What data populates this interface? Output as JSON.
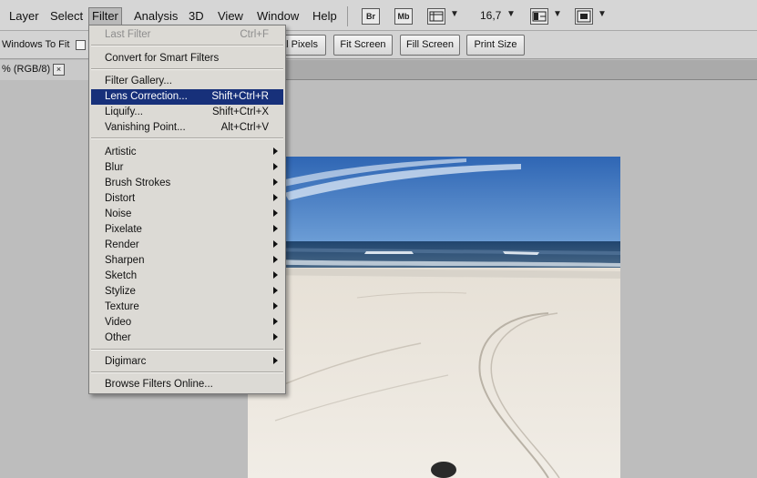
{
  "menubar": {
    "items": [
      "Layer",
      "Select",
      "Filter",
      "Analysis",
      "3D",
      "View",
      "Window",
      "Help"
    ],
    "bridge_icon": "Br",
    "minibridge_icon": "Mb",
    "zoom": "16,7"
  },
  "options": {
    "resize_label": "Windows To Fit",
    "buttons": [
      "al Pixels",
      "Fit Screen",
      "Fill Screen",
      "Print Size"
    ]
  },
  "document": {
    "tab_label": "% (RGB/8)",
    "close_glyph": "×"
  },
  "filter_menu": {
    "last_filter": {
      "label": "Last Filter",
      "shortcut": "Ctrl+F"
    },
    "convert": "Convert for Smart Filters",
    "group1": [
      {
        "label": "Filter Gallery...",
        "shortcut": ""
      },
      {
        "label": "Lens Correction...",
        "shortcut": "Shift+Ctrl+R"
      },
      {
        "label": "Liquify...",
        "shortcut": "Shift+Ctrl+X"
      },
      {
        "label": "Vanishing Point...",
        "shortcut": "Alt+Ctrl+V"
      }
    ],
    "submenus": [
      "Artistic",
      "Blur",
      "Brush Strokes",
      "Distort",
      "Noise",
      "Pixelate",
      "Render",
      "Sharpen",
      "Sketch",
      "Stylize",
      "Texture",
      "Video",
      "Other"
    ],
    "digimarc": "Digimarc",
    "browse": "Browse Filters Online..."
  },
  "colors": {
    "highlight": "#17307a",
    "menu_bg": "#dcdad5",
    "app_bg": "#bdbdbd"
  }
}
